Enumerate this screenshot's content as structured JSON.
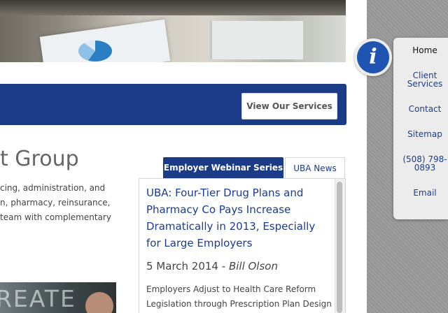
{
  "hero": {
    "icon": "office-photo"
  },
  "services_bar": {
    "button_label": "View Our Services"
  },
  "section": {
    "heading": "t Group",
    "intro_lines": [
      "cing, administration, and",
      "n, pharmacy, reinsurance,",
      " team with complementary"
    ],
    "video_caption": "REATE"
  },
  "news": {
    "tabs": [
      {
        "label": "Employer Webinar Series",
        "active": true
      },
      {
        "label": "UBA News",
        "active": false
      }
    ],
    "article": {
      "title": "UBA: Four-Tier Drug Plans and Pharmacy Co Pays Increase Dramatically in 2013, Especially for Large Employers",
      "date": "5 March 2014 - ",
      "author": "Bill Olson",
      "body_lines": [
        "Employers Adjust to Health Care Reform",
        "Legislation through Prescription Plan Design"
      ]
    }
  },
  "quick_links": {
    "icon": "info-icon",
    "items": [
      {
        "label": "Home",
        "active": true
      },
      {
        "label": "Client Services",
        "active": false
      },
      {
        "label": "Contact",
        "active": false
      },
      {
        "label": "Sitemap",
        "active": false
      },
      {
        "label": "(508) 798-0893",
        "active": false
      },
      {
        "label": "Email",
        "active": false
      }
    ]
  },
  "colors": {
    "brand_blue": "#1c3b87",
    "link_blue": "#1a3c96",
    "sidebar_grey": "#9a9a9a"
  }
}
